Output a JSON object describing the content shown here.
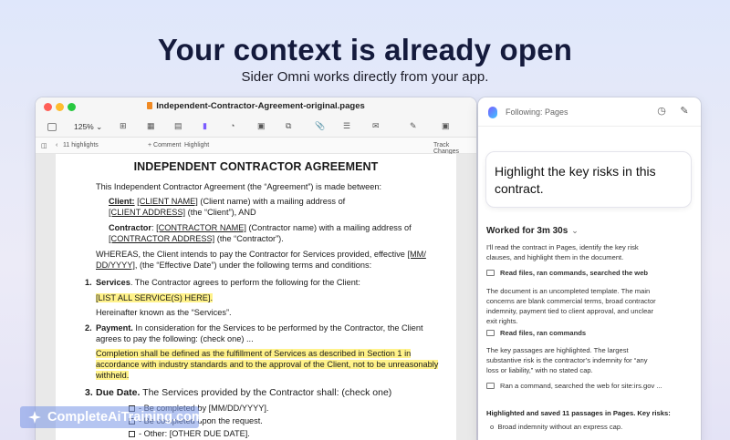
{
  "hero": {
    "title": "Your context is already open",
    "subtitle": "Sider Omni works directly from your app."
  },
  "pages_window": {
    "title": "Independent-Contractor-Agreement-original.pages",
    "zoom": "125%",
    "subbar": {
      "highlights": "11 highlights",
      "comment": "+ Comment",
      "highlight": "Highlight",
      "track_changes": "Track Changes"
    },
    "icons": [
      "sidebar-icon",
      "add-icon",
      "table-icon",
      "chart-icon",
      "text-icon",
      "shape-icon",
      "media-icon",
      "comment-icon",
      "format-icon",
      "document-icon"
    ]
  },
  "document": {
    "heading": "INDEPENDENT CONTRACTOR AGREEMENT",
    "intro": "This Independent Contractor Agreement (the “Agreement”) is made between:",
    "client_label": "Client:",
    "client_name": "[CLIENT NAME]",
    "client_mid": " (Client name) with a mailing address of",
    "client_address": "[CLIENT ADDRESS]",
    "client_tail": " (the “Client”), AND",
    "contractor_label": "Contractor",
    "contractor_name": "[CONTRACTOR NAME]",
    "contractor_mid": " (Contractor name) with a mailing address of",
    "contractor_address": "[CONTRACTOR ADDRESS]",
    "contractor_tail": " (the “Contractor”).",
    "whereas_1": "WHEREAS, the Client intends to pay the Contractor for Services provided, effective ",
    "whereas_date": "[MM/",
    "whereas_date_2": "DD/YYYY]",
    "whereas_2": ", (the “Effective Date”) under the following terms and conditions:",
    "s1_num": "1.",
    "s1_title": "Services",
    "s1_text": ". The Contractor agrees to perform the following for the Client:",
    "s1_list": "[LIST ALL SERVICE(S) HERE].",
    "s1_after": "Hereinafter known as the “Services”.",
    "s2_num": "2.",
    "s2_title": "Payment.",
    "s2_text_1": " In consideration for the Services to be performed by the Contractor, the Client",
    "s2_text_2": "agrees to pay the following: (check one)  ...",
    "s2_hl_1": "Completion shall be defined as the fulfillment of Services as described in Section 1 in",
    "s2_hl_2": "accordance with industry standards and to the approval of the Client, not to be unreasonably",
    "s2_hl_3": "withheld.",
    "s3_num": "3.",
    "s3_title": "Due Date.",
    "s3_text": " The Services provided by the Contractor shall: (check one)",
    "s3_opt1": "- Be completed by [MM/DD/YYYY].",
    "s3_opt2": "- Be completed upon the request.",
    "s3_opt3": "- Other: [OTHER DUE DATE]."
  },
  "sider": {
    "following": "Following: Pages",
    "prompt": "Highlight the key risks in this contract.",
    "worked": "Worked for 3m 30s",
    "intro": "I’ll read the contract in Pages, identify the key risk clauses, and highlight them in the document.",
    "step1": "Read files, ran commands, searched the web",
    "para1": "The document is an uncompleted template. The main concerns are blank commercial terms, broad contractor indemnity, payment tied to client approval, and unclear exit rights.",
    "step2": "Read files, ran commands",
    "para2": "The key passages are highlighted. The largest substantive risk is the contractor’s indemnity for “any loss or liability,” with no stated cap.",
    "step3": "Ran a command, searched the web for site:irs.gov ...",
    "summary": "Highlighted and saved 11 passages in Pages. Key risks:",
    "bullet1": "Broad indemnity without an express cap."
  },
  "watermark": "CompleteAiTraining.com",
  "colors": {
    "highlight": "#fff28a",
    "title": "#141a3c",
    "traffic_red": "#ff5f57",
    "traffic_yellow": "#febc2e",
    "traffic_green": "#28c840"
  }
}
